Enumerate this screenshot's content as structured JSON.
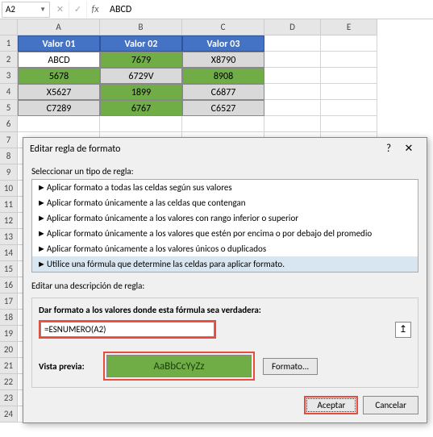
{
  "cellref": "A2",
  "formula_bar": "ABCD",
  "cols": [
    "A",
    "B",
    "C",
    "D",
    "E"
  ],
  "rows": [
    "1",
    "2",
    "3",
    "4",
    "5",
    "6",
    "7",
    "8",
    "9",
    "10",
    "11",
    "12",
    "13",
    "14",
    "15",
    "16",
    "17",
    "18",
    "19",
    "20",
    "21",
    "22",
    "23",
    "24"
  ],
  "table": {
    "h": [
      "Valor 01",
      "Valor 02",
      "Valor 03"
    ],
    "r": [
      [
        "ABCD",
        "7679",
        "X8790"
      ],
      [
        "5678",
        "6729V",
        "8908"
      ],
      [
        "X5627",
        "1899",
        "C6877"
      ],
      [
        "C7289",
        "6767",
        "C6527"
      ]
    ]
  },
  "dialog": {
    "title": "Editar regla de formato",
    "selectlabel": "Seleccionar un tipo de regla:",
    "rules": [
      "Aplicar formato a todas las celdas según sus valores",
      "Aplicar formato únicamente a las celdas que contengan",
      "Aplicar formato únicamente a los valores con rango inferior o superior",
      "Aplicar formato únicamente a los valores que estén por encima o por debajo del promedio",
      "Aplicar formato únicamente a los valores únicos o duplicados",
      "Utilice una fórmula que determine las celdas para aplicar formato."
    ],
    "editlabel": "Editar una descripción de regla:",
    "formula_label": "Dar formato a los valores donde esta fórmula sea verdadera:",
    "formula": "=ESNUMERO(A2)",
    "preview_label": "Vista previa:",
    "preview_text": "AaBbCcYyZz",
    "format_btn": "Formato...",
    "ok": "Aceptar",
    "cancel": "Cancelar"
  }
}
